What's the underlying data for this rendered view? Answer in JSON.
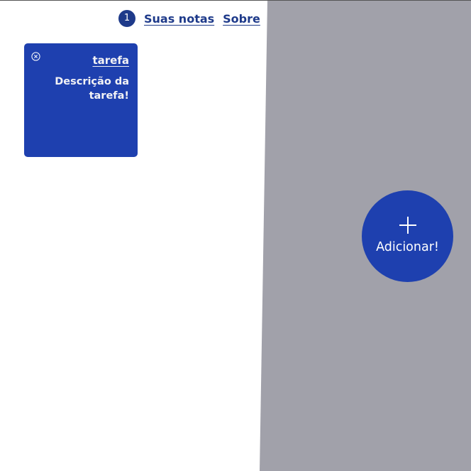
{
  "nav": {
    "note_count": "1",
    "notes_link": "Suas notas",
    "about_link": "Sobre"
  },
  "notes": [
    {
      "title": "tarefa",
      "description": "Descrição da tarefa!"
    }
  ],
  "add_button": {
    "label": "Adicionar!"
  },
  "icons": {
    "close": "close-circle-icon",
    "add": "plus-icon"
  },
  "colors": {
    "primary": "#1e40af",
    "nav_text": "#1e3a8a",
    "panel": "#a1a1aa",
    "background": "#ffffff"
  }
}
